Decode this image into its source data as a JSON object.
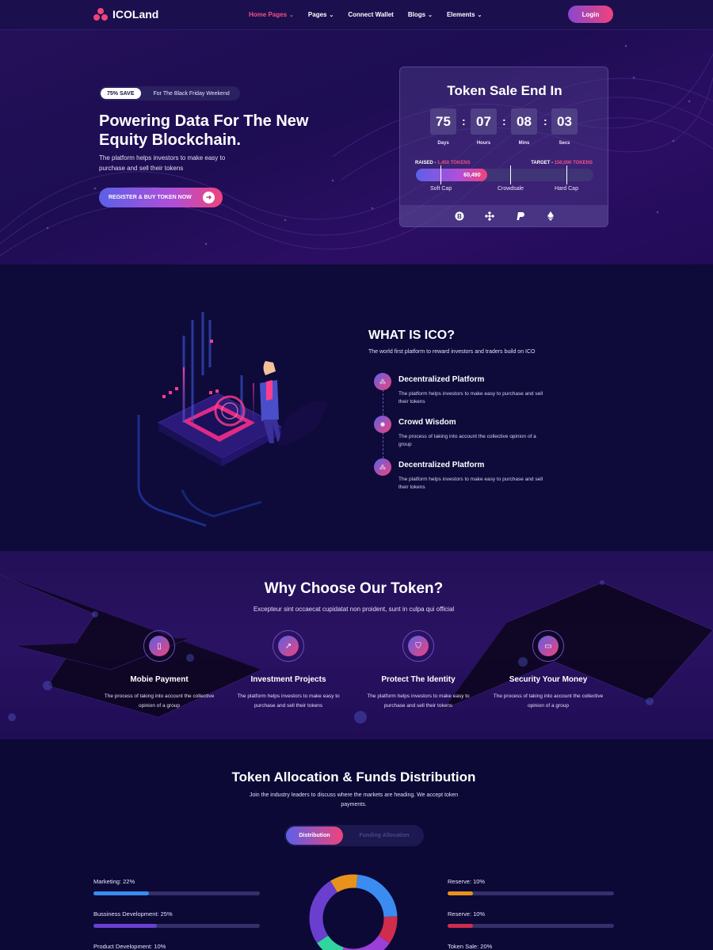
{
  "header": {
    "brand": "ICOLand",
    "nav": [
      {
        "label": "Home Pages",
        "active": true
      },
      {
        "label": "Pages"
      },
      {
        "label": "Connect Wallet"
      },
      {
        "label": "Blogs"
      },
      {
        "label": "Elements"
      }
    ],
    "login": "Login"
  },
  "hero": {
    "badge": "75% SAVE",
    "promo": "For The Black Friday Weekend",
    "title": "Powering Data For The New Equity Blockchain.",
    "subtitle": "The platform helps investors to make easy to purchase and sell their tokens",
    "cta": "REGISTER & BUY TOKEN NOW"
  },
  "sale": {
    "title": "Token Sale End In",
    "countdown": [
      {
        "value": "75",
        "label": "Days"
      },
      {
        "value": "07",
        "label": "Hours"
      },
      {
        "value": "08",
        "label": "Mins"
      },
      {
        "value": "03",
        "label": "Secs"
      }
    ],
    "raised_label": "RAISED -",
    "raised_value": "1,450 TOKENS",
    "target_label": "TARGET -",
    "target_value": "150,000 TOKENS",
    "progress_text": "60,490",
    "progress_fraction": 0.4,
    "caps": [
      "Soft Cap",
      "Crowdsale",
      "Hard Cap"
    ],
    "coins": [
      "bitcoin-icon",
      "binance-icon",
      "paypal-icon",
      "ethereum-icon"
    ]
  },
  "ico": {
    "title": "WHAT IS ICO?",
    "lead": "The world first platform to reward investors and traders build on ICO",
    "features": [
      {
        "title": "Decentralized Platform",
        "desc": "The platform helps investors to make easy to purchase and sell their tokens"
      },
      {
        "title": "Crowd Wisdom",
        "desc": "The process of taking into account the collective opinion of a group"
      },
      {
        "title": "Decentralized Platform",
        "desc": "The platform helps investors to make easy to purchase and sell their tokens"
      }
    ]
  },
  "why": {
    "title": "Why Choose Our Token?",
    "lead": "Excepteur sint occaecat cupidatat non proident, sunt in culpa qui official",
    "cards": [
      {
        "title": "Mobie Payment",
        "desc": "The process of taking into account the collective opinion of a group",
        "icon": "mobile-icon"
      },
      {
        "title": "Investment Projects",
        "desc": "The platform helps investors to make easy to purchase and sell their tokens",
        "icon": "chart-icon"
      },
      {
        "title": "Protect The Identity",
        "desc": "The platform helps investors to make easy to purchase and sell their tokens",
        "icon": "shield-icon"
      },
      {
        "title": "Security Your Money",
        "desc": "The process of taking into account the collective opinion of a group",
        "icon": "card-icon"
      }
    ]
  },
  "alloc": {
    "title": "Token Allocation & Funds Distribution",
    "lead": "Join the industry leaders to discuss where the markets are heading. We accept token payments.",
    "tabs": [
      "Distribution",
      "Funding Allocation"
    ],
    "left": [
      {
        "label": "Marketing: 22%",
        "value": 0.22,
        "color": "#3b8cf0"
      },
      {
        "label": "Bussiness Development: 25%",
        "value": 0.25,
        "color": "#6a3fd0"
      },
      {
        "label": "Product Development: 10%",
        "value": 0.1,
        "color": "#2fd6a0"
      }
    ],
    "right": [
      {
        "label": "Reserve: 10%",
        "value": 0.1,
        "color": "#e8921c"
      },
      {
        "label": "Reserve: 10%",
        "value": 0.1,
        "color": "#d02c4c"
      },
      {
        "label": "Token Sale: 20%",
        "value": 0.2,
        "color": "#9a3fd8"
      }
    ]
  },
  "chart_data": {
    "type": "pie",
    "categories": [
      "Marketing",
      "Bussiness Development",
      "Product Development",
      "Reserve",
      "Reserve",
      "Token Sale"
    ],
    "values": [
      22,
      25,
      10,
      10,
      10,
      20
    ],
    "colors": [
      "#3b8cf0",
      "#6a3fd0",
      "#2fd6a0",
      "#e8921c",
      "#d02c4c",
      "#9a3fd8"
    ]
  }
}
